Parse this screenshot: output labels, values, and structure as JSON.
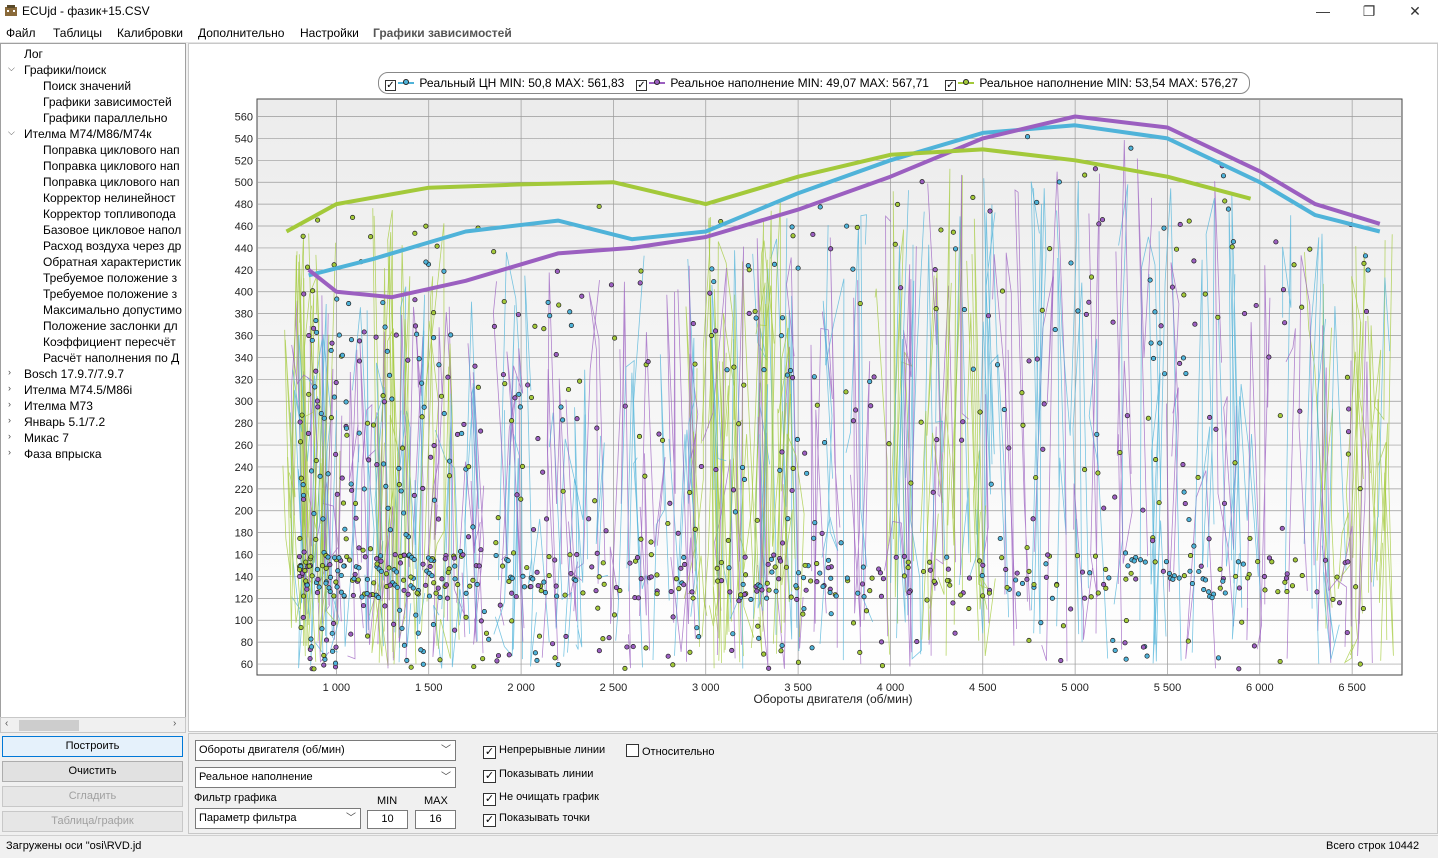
{
  "window": {
    "title": "ECUjd - фазик+15.CSV",
    "minimize_glyph": "—",
    "maximize_glyph": "❐",
    "close_glyph": "✕"
  },
  "menu": [
    "Файл",
    "Таблицы",
    "Калибровки",
    "Дополнительно",
    "Настройки",
    "Графики зависимостей"
  ],
  "tree": {
    "items": [
      {
        "label": "Лог",
        "level": 1,
        "arrow": ""
      },
      {
        "label": "Графики/поиск",
        "level": 1,
        "arrow": "open"
      },
      {
        "label": "Поиск значений",
        "level": 2,
        "arrow": ""
      },
      {
        "label": "Графики зависимостей",
        "level": 2,
        "arrow": ""
      },
      {
        "label": "Графики параллельно",
        "level": 2,
        "arrow": ""
      },
      {
        "label": "Ителма М74/М86/М74к",
        "level": 1,
        "arrow": "open"
      },
      {
        "label": "Поправка циклового нап",
        "level": 2,
        "arrow": ""
      },
      {
        "label": "Поправка циклового нап",
        "level": 2,
        "arrow": ""
      },
      {
        "label": "Поправка циклового нап",
        "level": 2,
        "arrow": ""
      },
      {
        "label": "Корректор нелинейност",
        "level": 2,
        "arrow": ""
      },
      {
        "label": "Корректор топливопода",
        "level": 2,
        "arrow": ""
      },
      {
        "label": "Базовое цикловое напол",
        "level": 2,
        "arrow": ""
      },
      {
        "label": "Расход воздуха через др",
        "level": 2,
        "arrow": ""
      },
      {
        "label": "Обратная характеристик",
        "level": 2,
        "arrow": ""
      },
      {
        "label": "Требуемое положение з",
        "level": 2,
        "arrow": ""
      },
      {
        "label": "Требуемое положение з",
        "level": 2,
        "arrow": ""
      },
      {
        "label": "Максимально допустимо",
        "level": 2,
        "arrow": ""
      },
      {
        "label": "Положение заслонки дл",
        "level": 2,
        "arrow": ""
      },
      {
        "label": "Коэффициент пересчёт",
        "level": 2,
        "arrow": ""
      },
      {
        "label": "Расчёт наполнения по Д",
        "level": 2,
        "arrow": ""
      },
      {
        "label": "Bosch 17.9.7/7.9.7",
        "level": 1,
        "arrow": "closed"
      },
      {
        "label": "Ителма М74.5/М86i",
        "level": 1,
        "arrow": "closed"
      },
      {
        "label": "Ителма М73",
        "level": 1,
        "arrow": "closed"
      },
      {
        "label": "Январь 5.1/7.2",
        "level": 1,
        "arrow": "closed"
      },
      {
        "label": "Микас 7",
        "level": 1,
        "arrow": "closed"
      },
      {
        "label": "Фаза впрыска",
        "level": 1,
        "arrow": "closed"
      }
    ]
  },
  "buttons": {
    "build": "Построить",
    "clear": "Очистить",
    "smooth": "Сгладить",
    "table_chart": "Таблица/график"
  },
  "legend": [
    {
      "label": "Реальный ЦН MIN: 50,8 MAX: 561,83",
      "color": "#4fb3d9",
      "checked": true
    },
    {
      "label": "Реальное наполнение MIN: 49,07 MAX: 567,71",
      "color": "#9b5fc0",
      "checked": true
    },
    {
      "label": "Реальное наполнение MIN: 53,54 MAX: 576,27",
      "color": "#a3c93a",
      "checked": true
    }
  ],
  "chart_data": {
    "type": "scatter",
    "xlabel": "Обороты  двигателя (об/мин)",
    "ylabel": "",
    "xlim": [
      570,
      6770
    ],
    "ylim": [
      50,
      576
    ],
    "x_ticks": [
      1000,
      1500,
      2000,
      2500,
      3000,
      3500,
      4000,
      4500,
      5000,
      5500,
      6000,
      6500
    ],
    "x_tick_labels": [
      "1 000",
      "1 500",
      "2 000",
      "2 500",
      "3 000",
      "3 500",
      "4 000",
      "4 500",
      "5 000",
      "5 500",
      "6 000",
      "6 500"
    ],
    "y_ticks": [
      60,
      80,
      100,
      120,
      140,
      160,
      180,
      200,
      220,
      240,
      260,
      280,
      300,
      320,
      340,
      360,
      380,
      400,
      420,
      440,
      460,
      480,
      500,
      520,
      540,
      560
    ],
    "grid": true,
    "series": [
      {
        "name": "Реальный ЦН",
        "color": "#4fb3d9",
        "envelope": [
          [
            850,
            415
          ],
          [
            1200,
            430
          ],
          [
            1700,
            455
          ],
          [
            2200,
            465
          ],
          [
            2600,
            448
          ],
          [
            3000,
            455
          ],
          [
            3500,
            490
          ],
          [
            4000,
            520
          ],
          [
            4500,
            545
          ],
          [
            5000,
            552
          ],
          [
            5500,
            540
          ],
          [
            6000,
            500
          ],
          [
            6300,
            470
          ],
          [
            6650,
            455
          ]
        ]
      },
      {
        "name": "Реальное наполнение",
        "color": "#9b5fc0",
        "envelope": [
          [
            850,
            420
          ],
          [
            1000,
            400
          ],
          [
            1300,
            395
          ],
          [
            1700,
            410
          ],
          [
            2200,
            435
          ],
          [
            2600,
            440
          ],
          [
            3000,
            450
          ],
          [
            3500,
            475
          ],
          [
            4000,
            505
          ],
          [
            4500,
            540
          ],
          [
            5000,
            560
          ],
          [
            5500,
            550
          ],
          [
            6000,
            510
          ],
          [
            6300,
            480
          ],
          [
            6650,
            462
          ]
        ]
      },
      {
        "name": "Реальное наполнение",
        "color": "#a3c93a",
        "envelope": [
          [
            730,
            455
          ],
          [
            1000,
            480
          ],
          [
            1500,
            495
          ],
          [
            2000,
            498
          ],
          [
            2500,
            500
          ],
          [
            3000,
            480
          ],
          [
            3500,
            505
          ],
          [
            4000,
            525
          ],
          [
            4500,
            530
          ],
          [
            5000,
            520
          ],
          [
            5500,
            505
          ],
          [
            5950,
            485
          ]
        ]
      }
    ]
  },
  "controls": {
    "x_param": "Обороты  двигателя (об/мин)",
    "y_param": "Реальное наполнение",
    "filter_label": "Фильтр графика",
    "filter_param": "Параметр фильтра",
    "min_label": "MIN",
    "max_label": "MAX",
    "min_value": "10",
    "max_value": "16",
    "checkboxes": [
      {
        "label": "Непрерывные линии",
        "checked": true
      },
      {
        "label": "Показывать линии",
        "checked": true
      },
      {
        "label": "Не очищать график",
        "checked": true
      },
      {
        "label": "Показывать точки",
        "checked": true
      }
    ],
    "relative": {
      "label": "Относительно",
      "checked": false
    }
  },
  "status": {
    "left": "Загружены оси \"osi\\RVD.jd",
    "right": "Всего строк 10442"
  }
}
